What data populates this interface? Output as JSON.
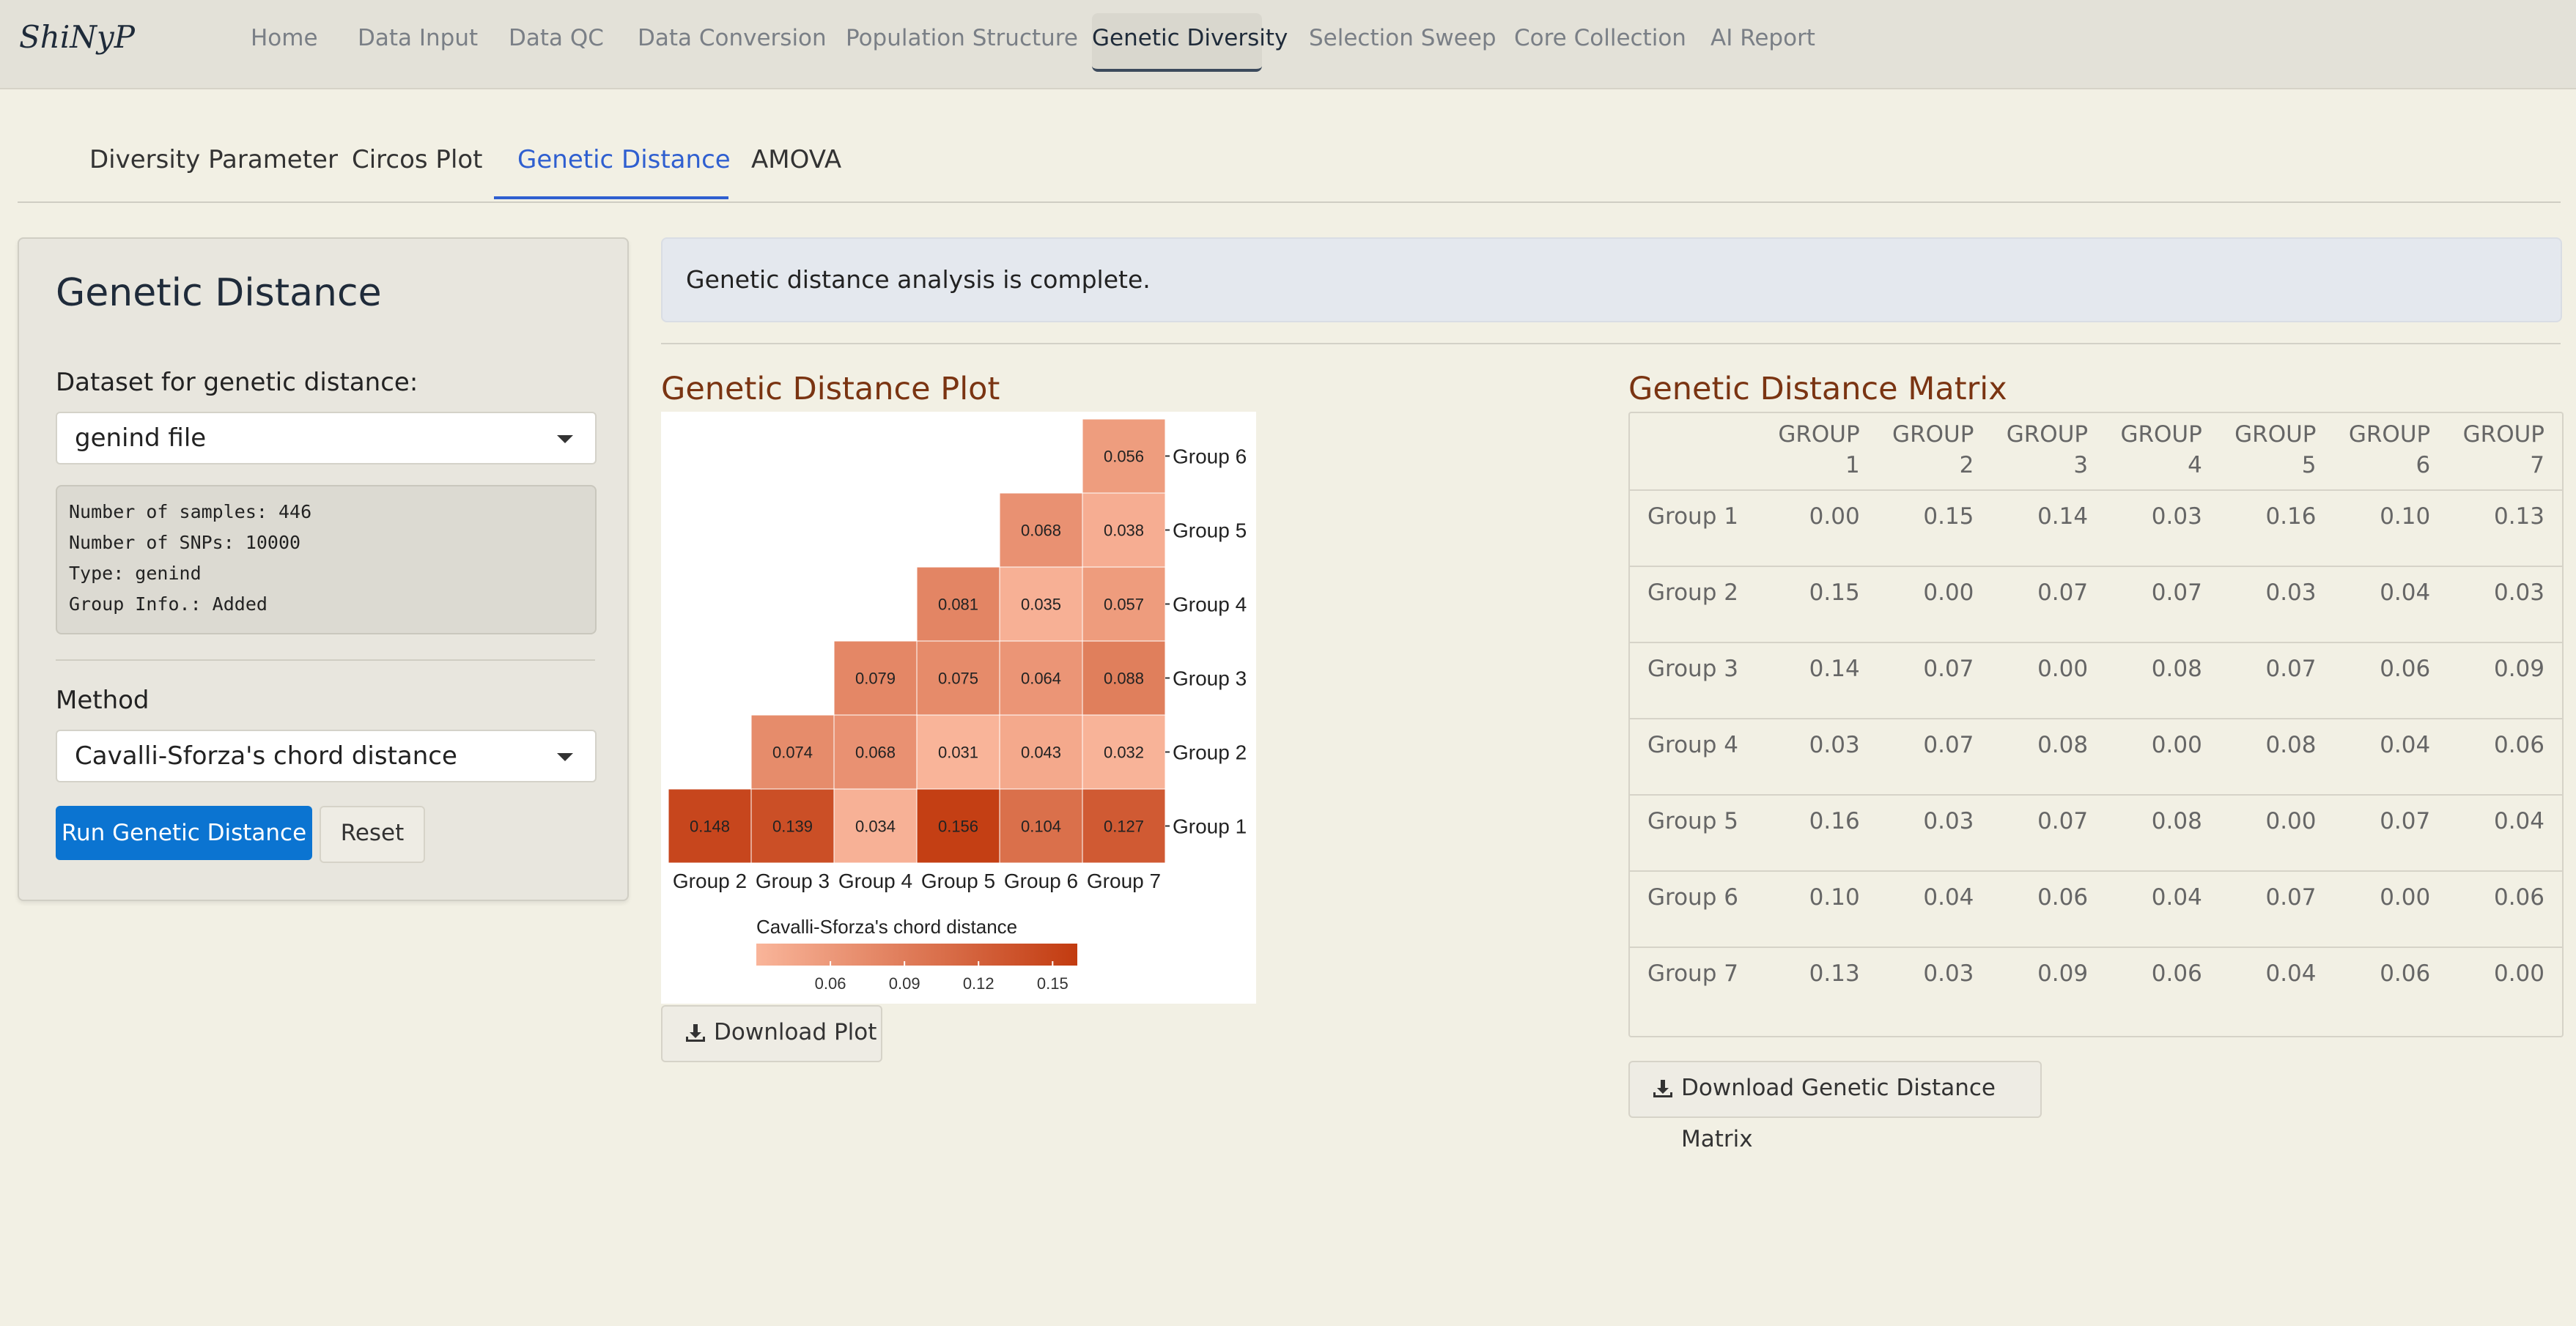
{
  "app": {
    "brand": "ShiNyP"
  },
  "nav": {
    "items": [
      "Home",
      "Data Input",
      "Data QC",
      "Data Conversion",
      "Population Structure",
      "Genetic Diversity",
      "Selection Sweep",
      "Core Collection",
      "AI Report"
    ],
    "active": "Genetic Diversity"
  },
  "subtabs": {
    "items": [
      "Diversity Parameter",
      "Circos Plot",
      "Genetic Distance",
      "AMOVA"
    ],
    "active": "Genetic Distance"
  },
  "sidebar": {
    "title": "Genetic Distance",
    "dataset_label": "Dataset for genetic distance:",
    "dataset_value": "genind file",
    "info": [
      "Number of samples: 446",
      "Number of SNPs: 10000",
      "Type: genind",
      "Group Info.: Added"
    ],
    "method_label": "Method",
    "method_value": "Cavalli-Sforza's chord distance",
    "run_label": "Run Genetic Distance",
    "reset_label": "Reset"
  },
  "alert": {
    "text": "Genetic distance analysis is complete."
  },
  "plot": {
    "title": "Genetic Distance Plot",
    "download_label": "Download Plot",
    "legend_title": "Cavalli-Sforza's chord distance",
    "legend_ticks": [
      "0.06",
      "0.09",
      "0.12",
      "0.15"
    ],
    "legend_colors": [
      "#f9b59a",
      "#c23b10"
    ]
  },
  "matrix": {
    "title": "Genetic Distance Matrix",
    "download_label": "Download Genetic Distance Matrix",
    "columns": [
      "GROUP 1",
      "GROUP 2",
      "GROUP 3",
      "GROUP 4",
      "GROUP 5",
      "GROUP 6",
      "GROUP 7"
    ],
    "rows": [
      {
        "name": "Group 1",
        "values": [
          "0.00",
          "0.15",
          "0.14",
          "0.03",
          "0.16",
          "0.10",
          "0.13"
        ]
      },
      {
        "name": "Group 2",
        "values": [
          "0.15",
          "0.00",
          "0.07",
          "0.07",
          "0.03",
          "0.04",
          "0.03"
        ]
      },
      {
        "name": "Group 3",
        "values": [
          "0.14",
          "0.07",
          "0.00",
          "0.08",
          "0.07",
          "0.06",
          "0.09"
        ]
      },
      {
        "name": "Group 4",
        "values": [
          "0.03",
          "0.07",
          "0.08",
          "0.00",
          "0.08",
          "0.04",
          "0.06"
        ]
      },
      {
        "name": "Group 5",
        "values": [
          "0.16",
          "0.03",
          "0.07",
          "0.08",
          "0.00",
          "0.07",
          "0.04"
        ]
      },
      {
        "name": "Group 6",
        "values": [
          "0.10",
          "0.04",
          "0.06",
          "0.04",
          "0.07",
          "0.00",
          "0.06"
        ]
      },
      {
        "name": "Group 7",
        "values": [
          "0.13",
          "0.03",
          "0.09",
          "0.06",
          "0.04",
          "0.06",
          "0.00"
        ]
      }
    ]
  },
  "chart_data": {
    "type": "heatmap",
    "x_categories": [
      "Group 2",
      "Group 3",
      "Group 4",
      "Group 5",
      "Group 6",
      "Group 7"
    ],
    "y_categories": [
      "Group 1",
      "Group 2",
      "Group 3",
      "Group 4",
      "Group 5",
      "Group 6"
    ],
    "cells": [
      {
        "x": "Group 2",
        "y": "Group 1",
        "value": 0.148,
        "label": "0.148"
      },
      {
        "x": "Group 3",
        "y": "Group 1",
        "value": 0.139,
        "label": "0.139"
      },
      {
        "x": "Group 4",
        "y": "Group 1",
        "value": 0.034,
        "label": "0.034"
      },
      {
        "x": "Group 5",
        "y": "Group 1",
        "value": 0.156,
        "label": "0.156"
      },
      {
        "x": "Group 6",
        "y": "Group 1",
        "value": 0.104,
        "label": "0.104"
      },
      {
        "x": "Group 7",
        "y": "Group 1",
        "value": 0.127,
        "label": "0.127"
      },
      {
        "x": "Group 3",
        "y": "Group 2",
        "value": 0.074,
        "label": "0.074"
      },
      {
        "x": "Group 4",
        "y": "Group 2",
        "value": 0.068,
        "label": "0.068"
      },
      {
        "x": "Group 5",
        "y": "Group 2",
        "value": 0.031,
        "label": "0.031"
      },
      {
        "x": "Group 6",
        "y": "Group 2",
        "value": 0.043,
        "label": "0.043"
      },
      {
        "x": "Group 7",
        "y": "Group 2",
        "value": 0.032,
        "label": "0.032"
      },
      {
        "x": "Group 4",
        "y": "Group 3",
        "value": 0.079,
        "label": "0.079"
      },
      {
        "x": "Group 5",
        "y": "Group 3",
        "value": 0.075,
        "label": "0.075"
      },
      {
        "x": "Group 6",
        "y": "Group 3",
        "value": 0.064,
        "label": "0.064"
      },
      {
        "x": "Group 7",
        "y": "Group 3",
        "value": 0.088,
        "label": "0.088"
      },
      {
        "x": "Group 5",
        "y": "Group 4",
        "value": 0.081,
        "label": "0.081"
      },
      {
        "x": "Group 6",
        "y": "Group 4",
        "value": 0.035,
        "label": "0.035"
      },
      {
        "x": "Group 7",
        "y": "Group 4",
        "value": 0.057,
        "label": "0.057"
      },
      {
        "x": "Group 6",
        "y": "Group 5",
        "value": 0.068,
        "label": "0.068"
      },
      {
        "x": "Group 7",
        "y": "Group 5",
        "value": 0.038,
        "label": "0.038"
      },
      {
        "x": "Group 7",
        "y": "Group 6",
        "value": 0.056,
        "label": "0.056"
      }
    ],
    "color_range": [
      0.03,
      0.16
    ],
    "legend_title": "Cavalli-Sforza's chord distance",
    "legend_ticks": [
      0.06,
      0.09,
      0.12,
      0.15
    ]
  }
}
